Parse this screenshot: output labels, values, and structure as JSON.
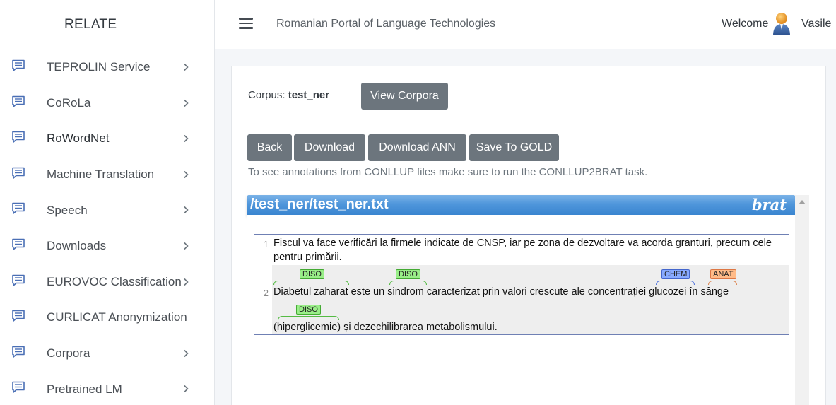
{
  "app": {
    "brand": "RELATE",
    "portal_title": "Romanian Portal of Language Technologies"
  },
  "user": {
    "welcome": "Welcome",
    "name": "Vasile"
  },
  "sidebar": {
    "items": [
      {
        "label": "TEPROLIN Service",
        "icon": "chat-icon",
        "has_chevron": true
      },
      {
        "label": "CoRoLa",
        "icon": "chat-icon",
        "has_chevron": true
      },
      {
        "label": "RoWordNet",
        "icon": "chat-icon",
        "has_chevron": true
      },
      {
        "label": "Machine Translation",
        "icon": "chat-icon",
        "has_chevron": true
      },
      {
        "label": "Speech",
        "icon": "chat-icon",
        "has_chevron": true
      },
      {
        "label": "Downloads",
        "icon": "chat-icon",
        "has_chevron": true
      },
      {
        "label": "EUROVOC Classification",
        "icon": "chat-icon",
        "has_chevron": true
      },
      {
        "label": "CURLICAT Anonymization",
        "icon": "chat-icon",
        "has_chevron": false
      },
      {
        "label": "Corpora",
        "icon": "chat-icon",
        "has_chevron": true
      },
      {
        "label": "Pretrained LM",
        "icon": "chat-icon",
        "has_chevron": true
      }
    ]
  },
  "main": {
    "corpus_label": "Corpus:",
    "corpus_name": "test_ner",
    "view_corpora": "View Corpora",
    "buttons": {
      "back": "Back",
      "download": "Download",
      "download_ann": "Download ANN",
      "save_gold": "Save To GOLD"
    },
    "hint": "To see annotations from CONLLUP files make sure to run the CONLLUP2BRAT task."
  },
  "brat": {
    "path": "/test_ner/test_ner.txt",
    "logo": "brat",
    "lines": {
      "n1": "1",
      "n2": "2",
      "l1a": "Fiscul va face verificări la firmele indicate de CNSP, iar pe zona de dezvoltare va acorda granturi, precum cele",
      "l1b": "pentru primării.",
      "l2a_pre": "Diabetul zaharat",
      "l2a_mid1": " este un ",
      "l2a_sindrom": "sindrom",
      "l2a_mid2": " caracterizat prin valori crescute ale concentrației ",
      "l2a_glucozei": "glucozei",
      "l2a_in": " în ",
      "l2a_sange": "sânge",
      "l2b_open": "(",
      "l2b_hiper": "hiperglicemie",
      "l2b_rest": ") și dezechilibrarea metabolismului."
    },
    "tags": {
      "diso": "DISO",
      "chem": "CHEM",
      "anat": "ANAT"
    },
    "colors": {
      "diso": "#99ee88",
      "chem": "#88aaff",
      "anat": "#ffbb88",
      "header": "#4f96db"
    }
  }
}
